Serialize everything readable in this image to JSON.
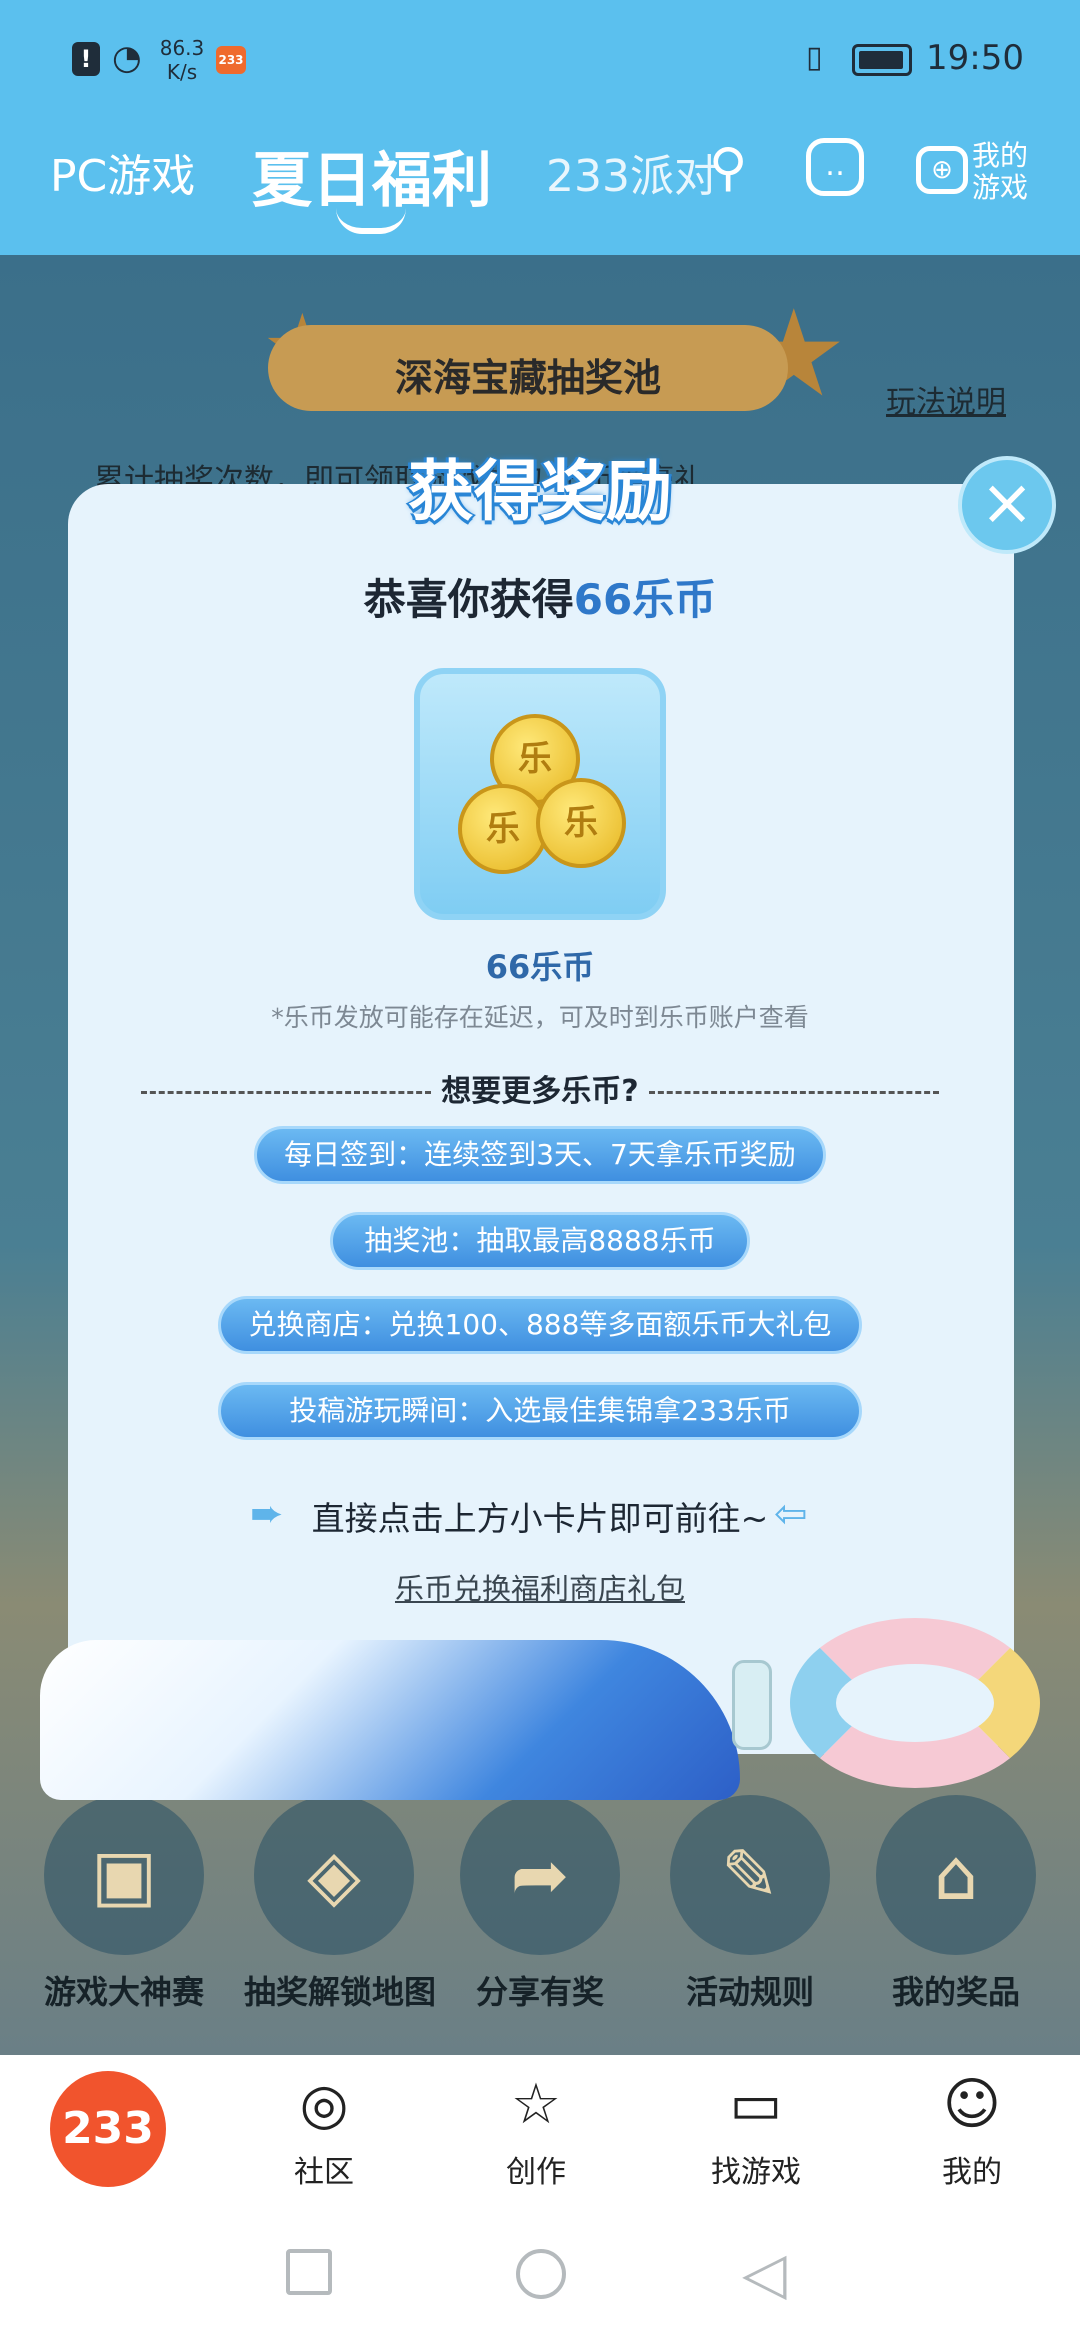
{
  "status_bar": {
    "net_speed": "86.3 K/s",
    "app_badge": "233",
    "time": "19:50"
  },
  "top_nav": {
    "tabs": [
      "PC游戏",
      "夏日福利",
      "233派对"
    ],
    "my_games": "我的游戏"
  },
  "page": {
    "pool_title": "深海宝藏抽奖池",
    "rules_link": "玩法说明",
    "accumulate_text": "累计抽奖次数，即可领取游戏礼包/乐币等豪礼",
    "entries": [
      "游戏大神赛",
      "抽奖解锁地图",
      "分享有奖",
      "活动规则",
      "我的奖品"
    ]
  },
  "modal": {
    "title": "获得奖励",
    "congrats_prefix": "恭喜你获得",
    "congrats_amount": "66乐币",
    "coin_glyph": "乐",
    "reward_name": "66乐币",
    "note": "*乐币发放可能存在延迟，可及时到乐币账户查看",
    "more_title": "想要更多乐币?",
    "pills": [
      "每日签到：连续签到3天、7天拿乐币奖励",
      "抽奖池：抽取最高8888乐币",
      "兑换商店：兑换100、888等多面额乐币大礼包",
      "投稿游玩瞬间：入选最佳集锦拿233乐币"
    ],
    "go_text": "直接点击上方小卡片即可前往~",
    "store_link": "乐币兑换福利商店礼包",
    "close_icon": "close-icon"
  },
  "bottom_nav": {
    "home": "233",
    "items": [
      "社区",
      "创作",
      "找游戏",
      "我的"
    ]
  },
  "colors": {
    "accent": "#5bc0ee",
    "amount": "#2f78c9",
    "brand_orange": "#f1542d"
  }
}
